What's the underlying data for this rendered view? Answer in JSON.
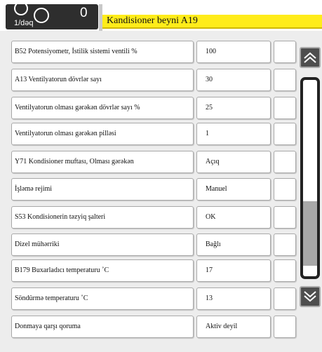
{
  "header": {
    "rate_label": "1/dəq",
    "counter": "0",
    "title": "Kandisioner beyni A19"
  },
  "rows": [
    {
      "label": "B52 Potensiyometr, İstilik sistemi ventili %",
      "value": "100"
    },
    {
      "label": "A13 Ventilyatorun dövrlər sayı",
      "value": "30"
    },
    {
      "label": "Ventilyatorun olması gərəkən dövrlər sayı %",
      "value": "25"
    },
    {
      "label": "Ventilyatorun olması gərəkən pilləsi",
      "value": "1"
    },
    {
      "label": "Y71 Kondisioner muftası, Olması gərəkən",
      "value": "Açıq"
    },
    {
      "label": "İşləmə rejimi",
      "value": "Manuel"
    },
    {
      "label": "S53 Kondisionerin təzyiq şalteri",
      "value": "OK"
    },
    {
      "label": "Dizel mühərriki",
      "value": "Bağlı"
    },
    {
      "label": "B179 Buxarladıcı temperaturu ˚C",
      "value": "17"
    },
    {
      "label": "Söndürmə temperaturu ˚C",
      "value": "13"
    },
    {
      "label": "Donmaya qarşı qoruma",
      "value": "Aktiv deyil"
    }
  ],
  "scrollbar": {
    "up_icon": "chevron-up-icon",
    "down_icon": "chevron-down-icon",
    "position": 0.92
  },
  "colors": {
    "title_bar": "#ffec1a",
    "header_dark": "#2e2e2e",
    "scroll_button": "#4e4e4e"
  }
}
